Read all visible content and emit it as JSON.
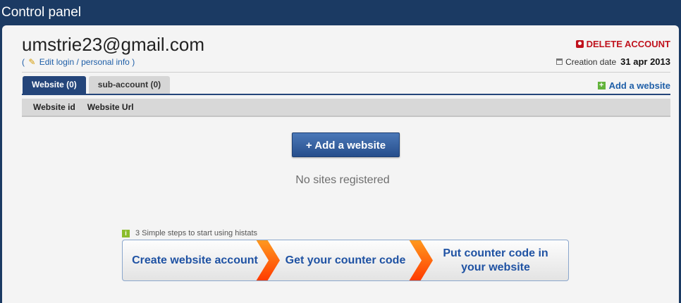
{
  "window": {
    "title": "Control panel"
  },
  "account": {
    "email": "umstrie23@gmail.com",
    "edit_open": "(",
    "edit_label": "Edit login / personal info",
    "edit_close": ")",
    "delete_label": "DELETE ACCOUNT",
    "creation_label": "Creation date",
    "creation_date": "31 apr 2013"
  },
  "tabs": [
    {
      "label": "Website (0)",
      "active": true
    },
    {
      "label": "sub-account (0)",
      "active": false
    }
  ],
  "add_link_label": "Add a website",
  "table": {
    "columns": [
      "Website id",
      "Website Url"
    ],
    "rows": []
  },
  "main": {
    "add_button_label": "+ Add a website",
    "empty_message": "No sites registered"
  },
  "steps": {
    "intro": "3 Simple steps to start using histats",
    "items": [
      {
        "line1": "Create website account",
        "line2": ""
      },
      {
        "line1": "Get your counter code",
        "line2": ""
      },
      {
        "line1": "Put counter code in",
        "line2": "your website"
      }
    ]
  },
  "colors": {
    "title_bar": "#1b3a63",
    "tab_active": "#24457a",
    "delete": "#c0121d",
    "link": "#1f5fa8",
    "step_text": "#1f52a3",
    "step_arrow": "#ff5a00"
  },
  "icons": {
    "edit": "pencil-icon",
    "delete": "user-delete-icon",
    "creation": "calendar-icon",
    "add": "plus-icon",
    "steps": "info-icon"
  }
}
